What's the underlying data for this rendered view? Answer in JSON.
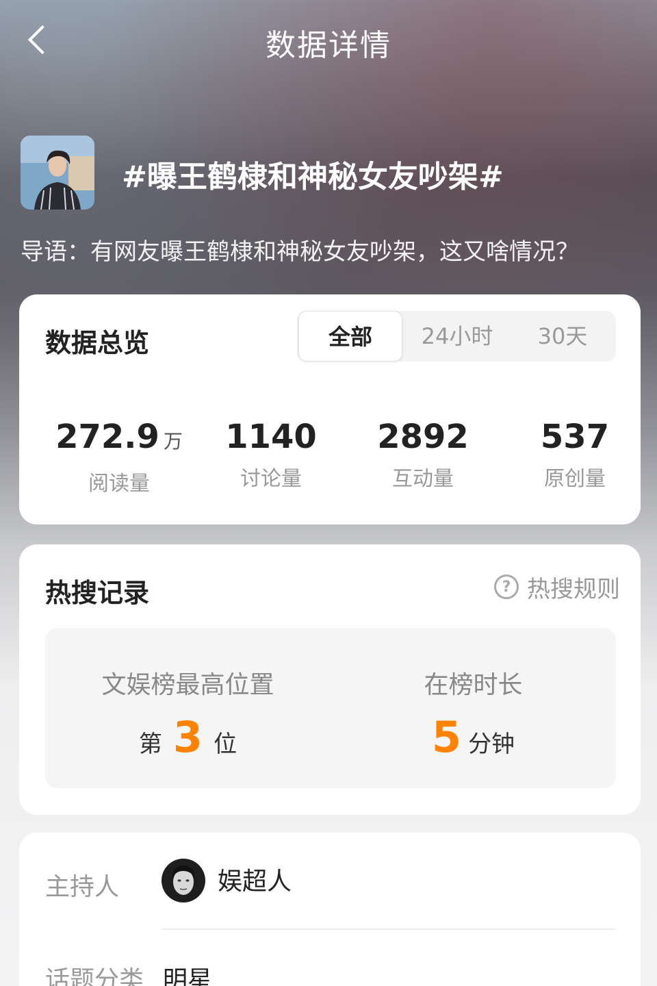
{
  "nav": {
    "title": "数据详情"
  },
  "topic": {
    "title": "#曝王鹤棣和神秘女友吵架#",
    "lead": "导语：有网友曝王鹤棣和神秘女友吵架，这又啥情况？"
  },
  "overview": {
    "title": "数据总览",
    "tabs": [
      {
        "label": "全部",
        "active": true
      },
      {
        "label": "24小时",
        "active": false
      },
      {
        "label": "30天",
        "active": false
      }
    ],
    "stats": [
      {
        "value": "272.9",
        "unit": "万",
        "label": "阅读量"
      },
      {
        "value": "1140",
        "unit": "",
        "label": "讨论量"
      },
      {
        "value": "2892",
        "unit": "",
        "label": "互动量"
      },
      {
        "value": "537",
        "unit": "",
        "label": "原创量"
      }
    ]
  },
  "hot": {
    "title": "热搜记录",
    "rule_link": "热搜规则",
    "rule_icon": "question-icon",
    "rank": {
      "label": "文娱榜最高位置",
      "prefix": "第",
      "value": "3",
      "suffix": "位"
    },
    "duration": {
      "label": "在榜时长",
      "value": "5",
      "suffix": "分钟"
    },
    "accent_color": "#ff8200"
  },
  "info": {
    "host_label": "主持人",
    "host_name": "娱超人",
    "category_label": "话题分类",
    "category_value": "明星"
  }
}
